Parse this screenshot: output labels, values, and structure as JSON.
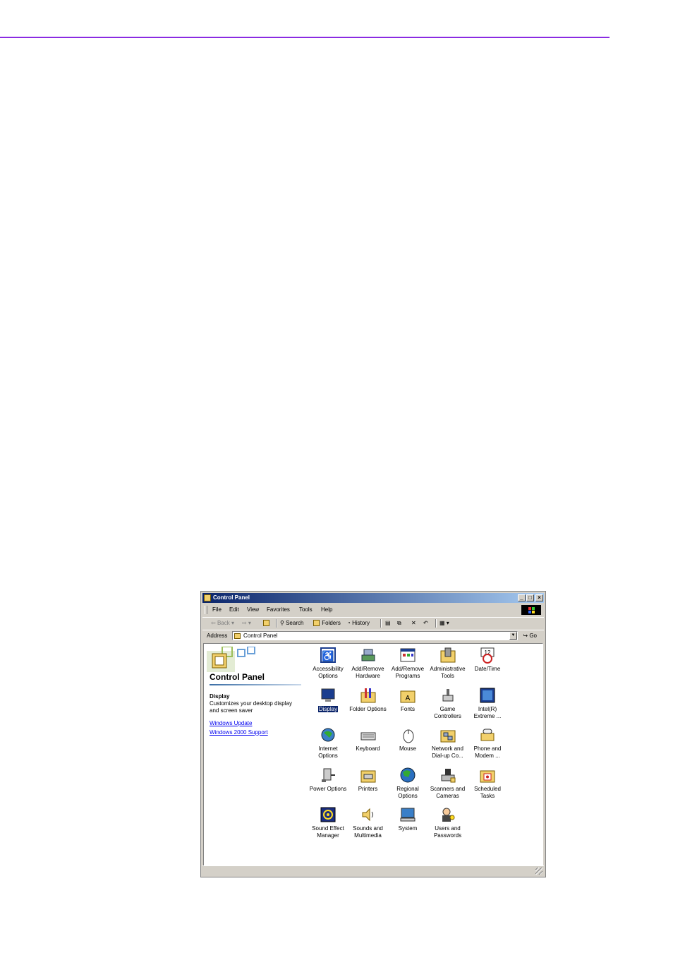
{
  "window": {
    "title": "Control Panel",
    "buttons": {
      "minimize": "_",
      "maximize": "□",
      "close": "×"
    }
  },
  "menu": [
    "File",
    "Edit",
    "View",
    "Favorites",
    "Tools",
    "Help"
  ],
  "toolbar": {
    "back": "Back",
    "search": "Search",
    "folders": "Folders",
    "history": "History"
  },
  "address": {
    "label": "Address",
    "value": "Control Panel",
    "go": "Go"
  },
  "side_pane": {
    "title": "Control Panel",
    "selected_title": "Display",
    "selected_desc": "Customizes your desktop display and screen saver",
    "links": [
      "Windows Update",
      "Windows 2000 Support"
    ]
  },
  "items": [
    {
      "label": "Accessibility Options",
      "icon": "accessibility-icon",
      "selected": false
    },
    {
      "label": "Add/Remove Hardware",
      "icon": "hardware-icon",
      "selected": false
    },
    {
      "label": "Add/Remove Programs",
      "icon": "programs-icon",
      "selected": false
    },
    {
      "label": "Administrative Tools",
      "icon": "admin-tools-icon",
      "selected": false
    },
    {
      "label": "Date/Time",
      "icon": "datetime-icon",
      "selected": false
    },
    {
      "label": "Display",
      "icon": "display-icon",
      "selected": true
    },
    {
      "label": "Folder Options",
      "icon": "folder-options-icon",
      "selected": false
    },
    {
      "label": "Fonts",
      "icon": "fonts-icon",
      "selected": false
    },
    {
      "label": "Game Controllers",
      "icon": "game-controllers-icon",
      "selected": false
    },
    {
      "label": "Intel(R) Extreme ...",
      "icon": "intel-graphics-icon",
      "selected": false
    },
    {
      "label": "Internet Options",
      "icon": "internet-options-icon",
      "selected": false
    },
    {
      "label": "Keyboard",
      "icon": "keyboard-icon",
      "selected": false
    },
    {
      "label": "Mouse",
      "icon": "mouse-icon",
      "selected": false
    },
    {
      "label": "Network and Dial-up Co...",
      "icon": "network-icon",
      "selected": false
    },
    {
      "label": "Phone and Modem ...",
      "icon": "phone-modem-icon",
      "selected": false
    },
    {
      "label": "Power Options",
      "icon": "power-options-icon",
      "selected": false
    },
    {
      "label": "Printers",
      "icon": "printers-icon",
      "selected": false
    },
    {
      "label": "Regional Options",
      "icon": "regional-options-icon",
      "selected": false
    },
    {
      "label": "Scanners and Cameras",
      "icon": "scanners-icon",
      "selected": false
    },
    {
      "label": "Scheduled Tasks",
      "icon": "scheduled-tasks-icon",
      "selected": false
    },
    {
      "label": "Sound Effect Manager",
      "icon": "sound-effect-icon",
      "selected": false
    },
    {
      "label": "Sounds and Multimedia",
      "icon": "sounds-icon",
      "selected": false
    },
    {
      "label": "System",
      "icon": "system-icon",
      "selected": false
    },
    {
      "label": "Users and Passwords",
      "icon": "users-icon",
      "selected": false
    }
  ],
  "colors": {
    "accent_rule": "#8a2be2",
    "titlebar_start": "#0a246a",
    "titlebar_end": "#a6caf0",
    "selection": "#0a246a",
    "link": "#0000ee"
  }
}
